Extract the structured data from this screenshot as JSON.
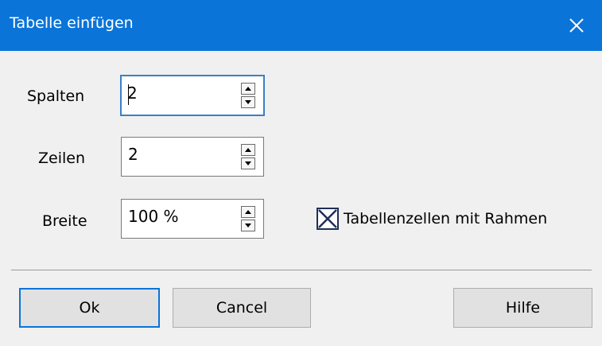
{
  "window": {
    "title": "Tabelle einfügen",
    "close_icon": "close-icon"
  },
  "form": {
    "columns": {
      "label": "Spalten",
      "value": "2"
    },
    "rows": {
      "label": "Zeilen",
      "value": "2"
    },
    "width": {
      "label": "Breite",
      "value": "100 %"
    },
    "border_checkbox": {
      "label": "Tabellenzellen mit Rahmen",
      "checked": true
    }
  },
  "buttons": {
    "ok": "Ok",
    "cancel": "Cancel",
    "help": "Hilfe"
  },
  "colors": {
    "titlebar": "#0a74d9",
    "dialog_bg": "#f0f0f0",
    "focus_border": "#3c7fc8",
    "checkbox_border": "#1f2f55"
  }
}
